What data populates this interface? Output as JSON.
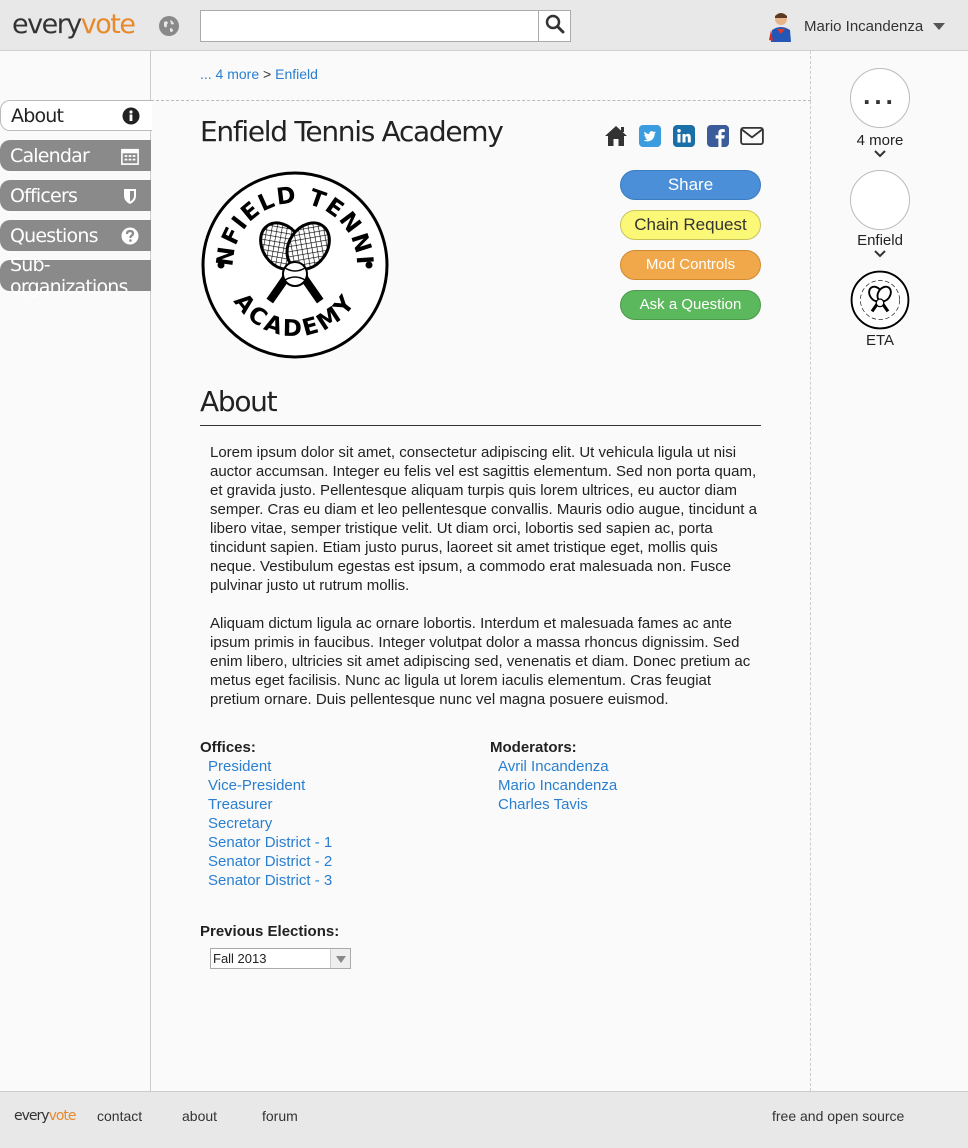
{
  "header": {
    "logo_part1": "every",
    "logo_part2": "vote",
    "search": {
      "value": "",
      "placeholder": ""
    },
    "user_name": "Mario Incandenza"
  },
  "sidebar": {
    "items": [
      {
        "label": "About",
        "icon": "info-icon",
        "active": true
      },
      {
        "label": "Calendar",
        "icon": "calendar-icon",
        "active": false
      },
      {
        "label": "Officers",
        "icon": "shield-icon",
        "active": false
      },
      {
        "label": "Questions",
        "icon": "question-icon",
        "active": false
      },
      {
        "label": "Sub-organizations",
        "icon": "",
        "active": false
      }
    ]
  },
  "breadcrumb": {
    "more": "... 4 more",
    "sep": ">",
    "current": "Enfield"
  },
  "org": {
    "title": "Enfield Tennis Academy",
    "logo_text_top": "ENFIELD TENNIS",
    "logo_text_bottom": "ACADEMY",
    "share_icons": [
      "home-icon",
      "twitter-icon",
      "linkedin-icon",
      "facebook-icon",
      "email-icon"
    ]
  },
  "actions": {
    "share": "Share",
    "chain_request": "Chain Request",
    "mod_controls": "Mod Controls",
    "ask_question": "Ask a Question"
  },
  "about": {
    "heading": "About",
    "paragraphs": [
      "Lorem ipsum dolor sit amet, consectetur adipiscing elit. Ut vehicula ligula ut nisi auctor accumsan. Integer eu felis vel est sagittis elementum. Sed non porta quam, et gravida justo. Pellentesque aliquam turpis quis lorem ultrices, eu auctor diam semper. Cras eu diam et leo pellentesque convallis. Mauris odio augue, tincidunt a libero vitae, semper tristique velit. Ut diam orci, lobortis sed sapien ac, porta tincidunt sapien. Etiam justo purus, laoreet sit amet tristique eget, mollis quis neque. Vestibulum egestas est ipsum, a commodo erat malesuada non. Fusce pulvinar justo ut rutrum mollis.",
      "Aliquam dictum ligula ac ornare lobortis. Interdum et malesuada fames ac ante ipsum primis in faucibus. Integer volutpat dolor a massa rhoncus dignissim. Sed enim libero, ultricies sit amet adipiscing sed, venenatis et diam. Donec pretium ac metus eget facilisis. Nunc ac ligula ut lorem iaculis elementum. Cras feugiat pretium ornare. Duis pellentesque nunc vel magna posuere euismod."
    ]
  },
  "offices": {
    "heading": "Offices:",
    "items": [
      "President",
      "Vice-President",
      "Treasurer",
      "Secretary",
      "Senator District - 1",
      "Senator District - 2",
      "Senator District - 3"
    ]
  },
  "moderators": {
    "heading": "Moderators:",
    "items": [
      "Avril Incandenza",
      "Mario Incandenza",
      "Charles Tavis"
    ]
  },
  "elections": {
    "heading": "Previous Elections:",
    "selected": "Fall 2013"
  },
  "rail": {
    "more_label": "4 more",
    "more_glyph": "...",
    "parent_label": "Enfield",
    "current_label": "ETA"
  },
  "footer": {
    "logo_part1": "every",
    "logo_part2": "vote",
    "links": [
      "contact",
      "about",
      "forum"
    ],
    "right": "free and open source"
  },
  "colors": {
    "accent": "#e8892a",
    "link": "#2a7fd0",
    "share": "#4a8fd8",
    "chain": "#fbf777",
    "mod": "#f0a84a",
    "ask": "#5cb85c"
  }
}
